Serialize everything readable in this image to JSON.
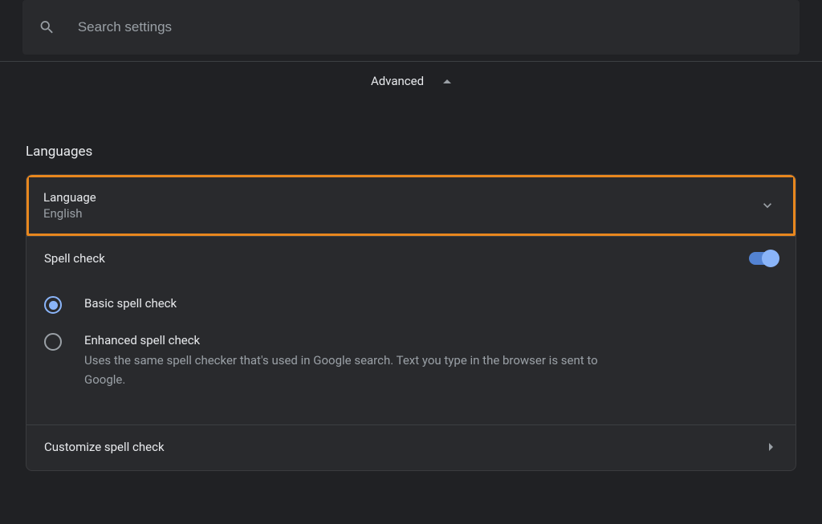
{
  "search": {
    "placeholder": "Search settings"
  },
  "advanced": {
    "label": "Advanced"
  },
  "languages": {
    "section_title": "Languages",
    "language_row": {
      "title": "Language",
      "value": "English"
    },
    "spell_check": {
      "label": "Spell check",
      "enabled": true,
      "options": {
        "basic": {
          "label": "Basic spell check",
          "selected": true
        },
        "enhanced": {
          "label": "Enhanced spell check",
          "description": "Uses the same spell checker that's used in Google search. Text you type in the browser is sent to Google.",
          "selected": false
        }
      },
      "customize_label": "Customize spell check"
    }
  }
}
